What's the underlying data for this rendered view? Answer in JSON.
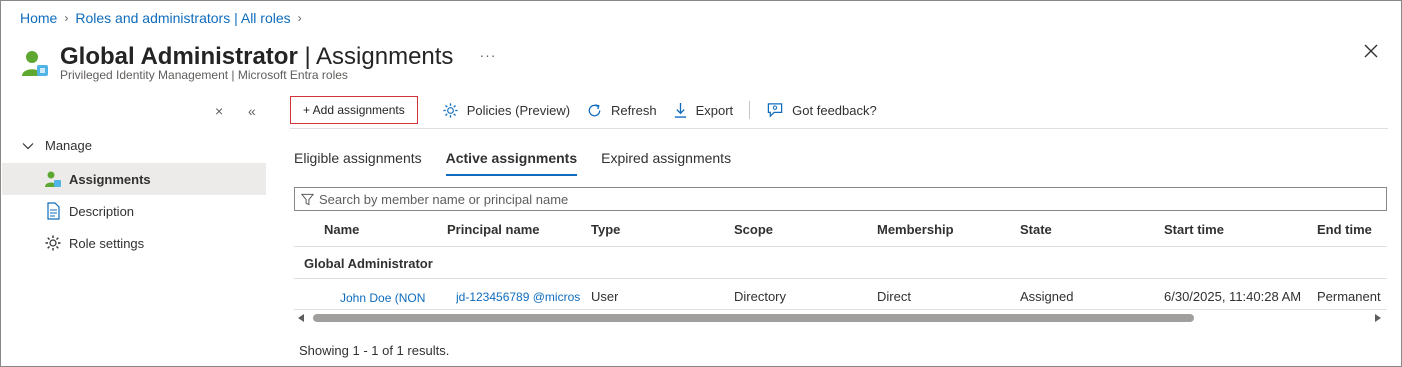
{
  "breadcrumb": {
    "items": [
      "Home",
      "Roles and administrators | All roles"
    ]
  },
  "header": {
    "title_bold": "Global Administrator",
    "title_rest": " | Assignments",
    "more_label": "···",
    "subtitle": "Privileged Identity Management | Microsoft Entra roles",
    "close_icon": "close-icon"
  },
  "sidebar": {
    "collapse_label": "×",
    "minimize_label": "«",
    "group_label": "Manage",
    "items": [
      {
        "label": "Assignments",
        "icon": "user-role-icon",
        "active": true
      },
      {
        "label": "Description",
        "icon": "document-icon",
        "active": false
      },
      {
        "label": "Role settings",
        "icon": "gear-icon",
        "active": false
      }
    ]
  },
  "toolbar": {
    "add_label": "+ Add assignments",
    "policies_label": "Policies (Preview)",
    "refresh_label": "Refresh",
    "export_label": "Export",
    "feedback_label": "Got feedback?"
  },
  "tabs": [
    {
      "label": "Eligible assignments",
      "active": false
    },
    {
      "label": "Active assignments",
      "active": true
    },
    {
      "label": "Expired assignments",
      "active": false
    }
  ],
  "search": {
    "placeholder": "Search by member name or principal name"
  },
  "table": {
    "columns": [
      "Name",
      "Principal name",
      "Type",
      "Scope",
      "Membership",
      "State",
      "Start time",
      "End time"
    ],
    "group": "Global Administrator",
    "rows": [
      {
        "name": "John Doe (NON",
        "principal": "jd-123456789 @micros",
        "type": "User",
        "scope": "Directory",
        "membership": "Direct",
        "state": "Assigned",
        "start": "6/30/2025, 11:40:28 AM",
        "end": "Permanent"
      }
    ]
  },
  "footer": {
    "results": "Showing 1 - 1 of 1 results."
  },
  "colors": {
    "link": "#0f6cbd",
    "accent_border": "#d13438",
    "selected_bg": "#edebe9"
  }
}
